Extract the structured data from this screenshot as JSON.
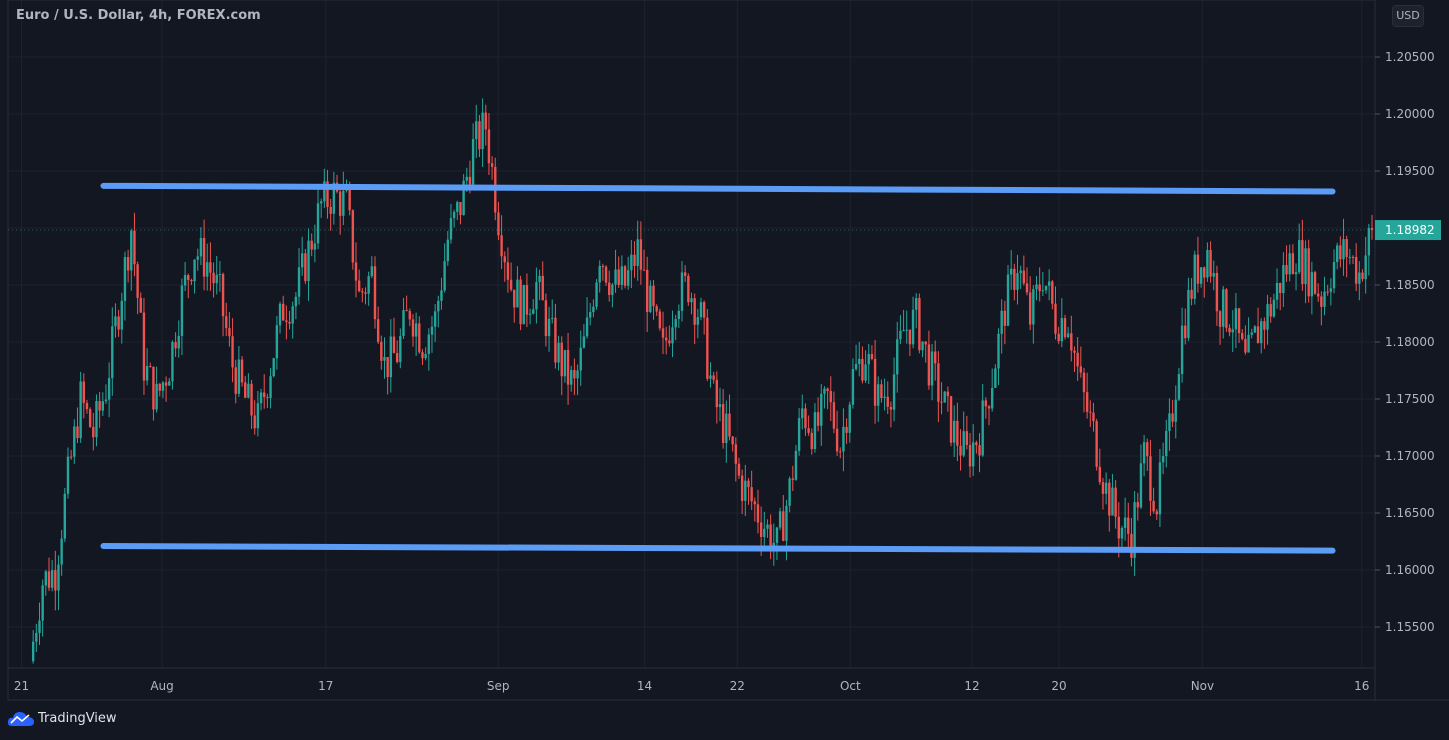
{
  "header": {
    "title": "Euro / U.S. Dollar, 4h, FOREX.com",
    "currency": "USD"
  },
  "footer": {
    "brand": "TradingView"
  },
  "colors": {
    "background": "#131722",
    "up": "#26a69a",
    "down": "#ef5350",
    "trendline": "#5b9cf6",
    "grid": "#1e222d"
  },
  "chart_data": {
    "type": "candlestick",
    "title": "Euro / U.S. Dollar, 4h, FOREX.com",
    "ylim": [
      1.1508,
      1.2095
    ],
    "yticks": [
      "1.15500",
      "1.16000",
      "1.16500",
      "1.17000",
      "1.17500",
      "1.18000",
      "1.18500",
      "1.19000",
      "1.19500",
      "1.20000",
      "1.20500"
    ],
    "ytick_values": [
      1.155,
      1.16,
      1.165,
      1.17,
      1.175,
      1.18,
      1.185,
      1.19,
      1.195,
      1.2,
      1.205
    ],
    "xticks": [
      "21",
      "Aug",
      "17",
      "Sep",
      "14",
      "22",
      "Oct",
      "12",
      "20",
      "Nov",
      "16"
    ],
    "xtick_positions": [
      0.01,
      0.107,
      0.22,
      0.339,
      0.44,
      0.504,
      0.582,
      0.666,
      0.726,
      0.825,
      0.935
    ],
    "last_price": "1.18982",
    "last_price_value": 1.18982,
    "closes": [
      1.152,
      1.159,
      1.16,
      1.168,
      1.175,
      1.172,
      1.176,
      1.183,
      1.19,
      1.178,
      1.175,
      1.178,
      1.184,
      1.188,
      1.187,
      1.184,
      1.178,
      1.175,
      1.173,
      1.178,
      1.183,
      1.184,
      1.188,
      1.192,
      1.193,
      1.192,
      1.184,
      1.186,
      1.178,
      1.179,
      1.183,
      1.18,
      1.182,
      1.189,
      1.192,
      1.197,
      1.199,
      1.191,
      1.185,
      1.183,
      1.185,
      1.181,
      1.178,
      1.176,
      1.181,
      1.188,
      1.185,
      1.185,
      1.188,
      1.183,
      1.179,
      1.184,
      1.185,
      1.182,
      1.175,
      1.172,
      1.168,
      1.166,
      1.164,
      1.162,
      1.167,
      1.174,
      1.172,
      1.175,
      1.171,
      1.177,
      1.179,
      1.175,
      1.176,
      1.181,
      1.182,
      1.178,
      1.175,
      1.172,
      1.17,
      1.172,
      1.177,
      1.183,
      1.187,
      1.182,
      1.186,
      1.182,
      1.182,
      1.176,
      1.172,
      1.167,
      1.164,
      1.163,
      1.17,
      1.166,
      1.172,
      1.181,
      1.186,
      1.188,
      1.183,
      1.182,
      1.178,
      1.181,
      1.183,
      1.186,
      1.188,
      1.186,
      1.184,
      1.187,
      1.188,
      1.186,
      1.18982
    ],
    "trendlines": [
      {
        "name": "resistance",
        "from": [
          0.07,
          1.1937
        ],
        "to": [
          0.97,
          1.1932
        ]
      },
      {
        "name": "support",
        "from": [
          0.07,
          1.1621
        ],
        "to": [
          0.97,
          1.1617
        ]
      }
    ]
  }
}
